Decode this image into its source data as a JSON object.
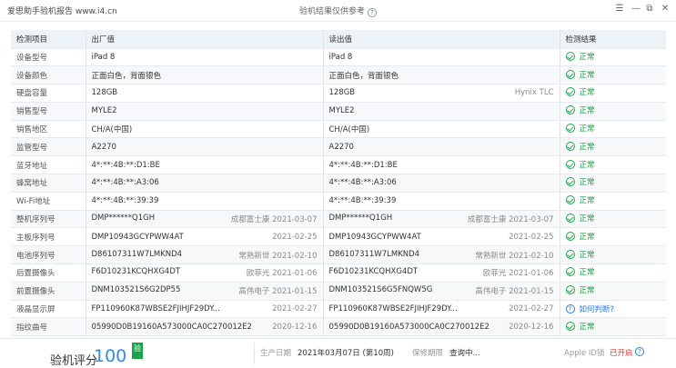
{
  "app": {
    "title": "爱思助手验机报告 www.i4.cn",
    "center_title": "验机结果仅供参考"
  },
  "window_controls": {
    "menu": "☰",
    "minimize": "—",
    "restore": "⧉",
    "close": "✕"
  },
  "table": {
    "headers": {
      "item": "检测项目",
      "factory": "出厂值",
      "read": "读出值",
      "result": "检测结果"
    },
    "rows": [
      {
        "item": "设备型号",
        "factory": "iPad 8",
        "factory_meta": "",
        "read": "iPad 8",
        "read_meta": "",
        "result": "正常",
        "result_type": "ok"
      },
      {
        "item": "设备颜色",
        "factory": "正面白色，背面银色",
        "factory_meta": "",
        "read": "正面白色，背面银色",
        "read_meta": "",
        "result": "正常",
        "result_type": "ok"
      },
      {
        "item": "硬盘容量",
        "factory": "128GB",
        "factory_meta": "",
        "read": "128GB",
        "read_meta": "Hynix TLC",
        "result": "正常",
        "result_type": "ok"
      },
      {
        "item": "销售型号",
        "factory": "MYLE2",
        "factory_meta": "",
        "read": "MYLE2",
        "read_meta": "",
        "result": "正常",
        "result_type": "ok"
      },
      {
        "item": "销售地区",
        "factory": "CH/A(中国)",
        "factory_meta": "",
        "read": "CH/A(中国)",
        "read_meta": "",
        "result": "正常",
        "result_type": "ok"
      },
      {
        "item": "监管型号",
        "factory": "A2270",
        "factory_meta": "",
        "read": "A2270",
        "read_meta": "",
        "result": "正常",
        "result_type": "ok"
      },
      {
        "item": "蓝牙地址",
        "factory": "4*:**:4B:**:D1:BE",
        "factory_meta": "",
        "read": "4*:**:4B:**:D1:BE",
        "read_meta": "",
        "result": "正常",
        "result_type": "ok"
      },
      {
        "item": "蜂窝地址",
        "factory": "4*:**:4B:**:A3:06",
        "factory_meta": "",
        "read": "4*:**:4B:**:A3:06",
        "read_meta": "",
        "result": "正常",
        "result_type": "ok"
      },
      {
        "item": "Wi-Fi地址",
        "factory": "4*:**:4B:**:39:39",
        "factory_meta": "",
        "read": "4*:**:4B:**:39:39",
        "read_meta": "",
        "result": "正常",
        "result_type": "ok"
      },
      {
        "item": "整机序列号",
        "factory": "DMP******Q1GH",
        "factory_meta": "成都富士康 2021-03-07",
        "read": "DMP******Q1GH",
        "read_meta": "成都富士康 2021-03-07",
        "result": "正常",
        "result_type": "ok"
      },
      {
        "item": "主板序列号",
        "factory": "DMP10943GCYPWW4AT",
        "factory_meta": "2021-02-25",
        "read": "DMP10943GCYPWW4AT",
        "read_meta": "2021-02-25",
        "result": "正常",
        "result_type": "ok"
      },
      {
        "item": "电池序列号",
        "factory": "D86107311W7LMKND4",
        "factory_meta": "常熟新世 2021-02-10",
        "read": "D86107311W7LMKND4",
        "read_meta": "常熟新世 2021-02-10",
        "result": "正常",
        "result_type": "ok"
      },
      {
        "item": "后置摄像头",
        "factory": "F6D10231KCQHXG4DT",
        "factory_meta": "欧菲光 2021-01-06",
        "read": "F6D10231KCQHXG4DT",
        "read_meta": "欧菲光 2021-01-06",
        "result": "正常",
        "result_type": "ok"
      },
      {
        "item": "前置摄像头",
        "factory": "DNM103521S6G2DP55",
        "factory_meta": "高伟电子 2021-01-15",
        "read": "DNM103521S6G5FNQW5G",
        "read_meta": "高伟电子 2021-01-15",
        "result": "正常",
        "result_type": "ok"
      },
      {
        "item": "液晶显示屏",
        "factory": "FP110960K87WBSE2FJIHJF29DY...",
        "factory_meta": "2021-02-27",
        "read": "FP110960K87WBSE2FJIHJF29DY...",
        "read_meta": "2021-02-27",
        "result": "如何判断?",
        "result_type": "question"
      },
      {
        "item": "指纹曲号",
        "factory": "05990D0B19160A573000CA0C270012E2",
        "factory_meta": "2020-12-16",
        "read": "05990D0B19160A573000CA0C270012E2",
        "read_meta": "2020-12-16",
        "result": "正常",
        "result_type": "ok"
      }
    ]
  },
  "bottom": {
    "score_label": "验机评分",
    "score_value": "100",
    "badge": "验",
    "production_label": "生产日期",
    "production_value": "2021年03月07日 (第10周)",
    "warranty_label": "保修期限",
    "warranty_value": "查询中...",
    "appleid_label": "Apple ID锁",
    "appleid_value": "已开启"
  },
  "colors": {
    "ok": "#1fa94a",
    "link": "#2b7bd3",
    "score": "#2f8ee0",
    "warn": "#e23b3b"
  }
}
